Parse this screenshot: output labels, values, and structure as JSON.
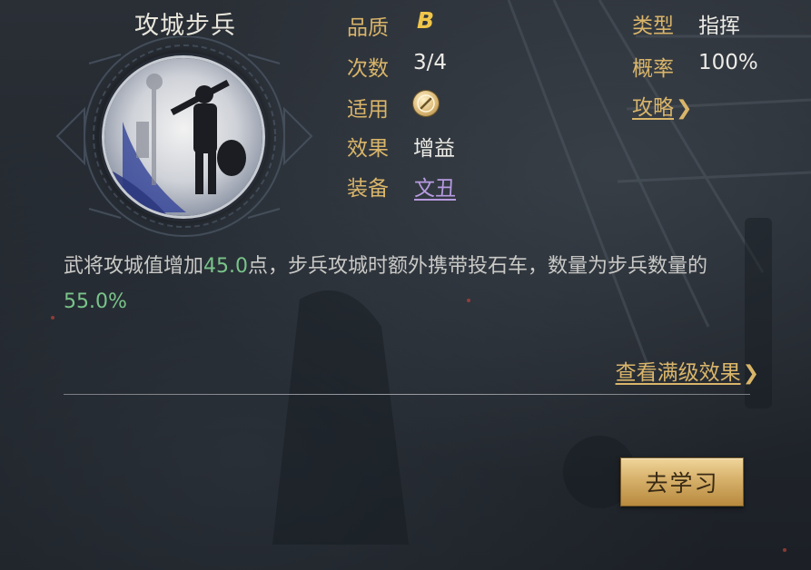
{
  "skill": {
    "name": "攻城步兵",
    "icon": "infantry-portrait-icon"
  },
  "attributes": {
    "quality_label": "品质",
    "quality_value": "B",
    "count_label": "次数",
    "count_value": "3/4",
    "apply_label": "适用",
    "apply_icon": "troop-type-badge-icon",
    "effect_label": "效果",
    "effect_value": "增益",
    "equip_label": "装备",
    "equip_value": "文丑",
    "type_label": "类型",
    "type_value": "指挥",
    "rate_label": "概率",
    "rate_value": "100%",
    "strategy_label": "攻略"
  },
  "description": {
    "part1": "武将攻城值增加",
    "value1": "45.0",
    "part2": "点，步兵攻城时额外携带投石车，数量为步兵数量的",
    "value2": "55.0%"
  },
  "links": {
    "view_full": "查看满级效果"
  },
  "actions": {
    "learn_label": "去学习"
  },
  "colors": {
    "label_gold": "#d9b56a",
    "highlight_green": "#79c48a",
    "link_purple": "#b69ae0",
    "button_gold": "#d6b06a",
    "background": "#23282f"
  }
}
